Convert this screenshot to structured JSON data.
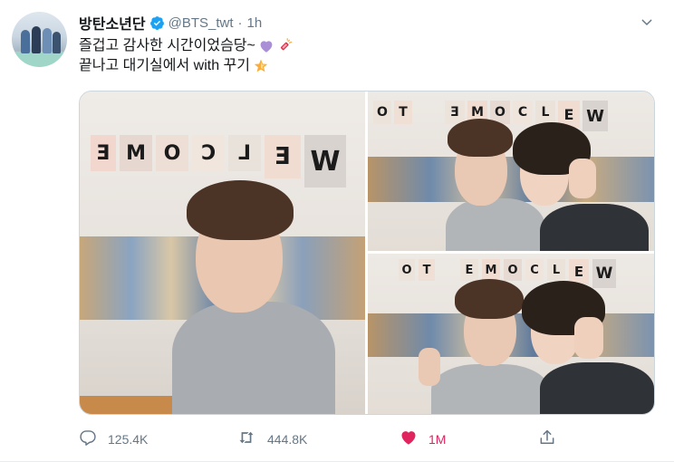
{
  "tweet": {
    "author": {
      "display_name": "방탄소년단",
      "handle": "@BTS_twt",
      "verified": true,
      "avatar_icon": "group-photo-avatar"
    },
    "separator": "·",
    "timestamp": "1h",
    "text_lines": [
      "즐겁고 감사한 시간이었슴당~",
      "끝나고 대기실에서 with 꾸기"
    ],
    "emojis": {
      "line1": [
        "purple-heart-icon",
        "firecracker-icon"
      ],
      "line2": [
        "star-icon"
      ]
    },
    "media": {
      "photo_count": 3,
      "banner_letters": [
        "W",
        "E",
        "L",
        "C",
        "O",
        "M",
        "E",
        "T",
        "O"
      ]
    },
    "actions": {
      "reply_count": "125.4K",
      "retweet_count": "444.8K",
      "like_count": "1M",
      "liked": true
    }
  },
  "colors": {
    "text_primary": "#14171a",
    "text_secondary": "#657786",
    "verified_blue": "#1da1f2",
    "like_red": "#e0245e",
    "border": "#ccd6dd"
  }
}
